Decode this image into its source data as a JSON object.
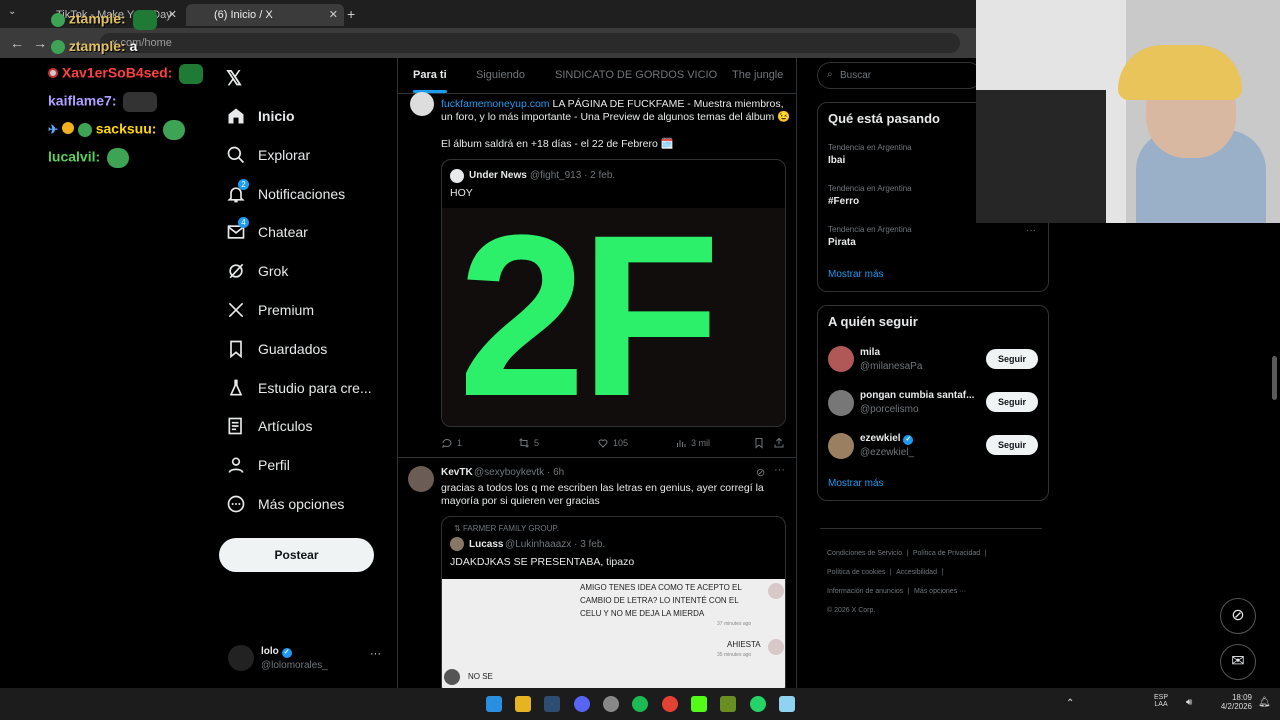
{
  "browser": {
    "tabs": [
      {
        "label": "TikTok - Make Your Day"
      },
      {
        "label": "(6) Inicio / X"
      }
    ],
    "url": "x.com/home"
  },
  "chat": [
    {
      "user": "ztample:",
      "msg": "",
      "color": "#e0c060"
    },
    {
      "user": "ztample:",
      "msg": "a",
      "color": "#e0c060"
    },
    {
      "user": "Xav1erSoB4sed:",
      "msg": "",
      "color": "#ff4040"
    },
    {
      "user": "kaiflame7:",
      "msg": "",
      "color": "#b0a0ff"
    },
    {
      "user": "sacksuu:",
      "msg": "",
      "color": "#ffd700"
    },
    {
      "user": "lucalvil:",
      "msg": "",
      "color": "#5bd05b"
    }
  ],
  "sidebar": {
    "items": [
      {
        "label": "Inicio",
        "icon": "home-icon"
      },
      {
        "label": "Explorar",
        "icon": "search-icon"
      },
      {
        "label": "Notificaciones",
        "icon": "bell-icon",
        "badge": "2"
      },
      {
        "label": "Chatear",
        "icon": "mail-icon",
        "badge": "4"
      },
      {
        "label": "Grok",
        "icon": "grok-icon"
      },
      {
        "label": "Premium",
        "icon": "x-icon"
      },
      {
        "label": "Guardados",
        "icon": "bookmark-icon"
      },
      {
        "label": "Estudio para cre...",
        "icon": "flask-icon"
      },
      {
        "label": "Artículos",
        "icon": "article-icon"
      },
      {
        "label": "Perfil",
        "icon": "person-icon"
      },
      {
        "label": "Más opciones",
        "icon": "more-icon"
      }
    ],
    "post_label": "Postear",
    "account": {
      "name": "lolo",
      "handle": "@lolomorales_"
    }
  },
  "main": {
    "tabs": [
      "Para ti",
      "Siguiendo",
      "SINDICATO DE GORDOS VICIO",
      "The jungle"
    ],
    "post1": {
      "link": "fuckfamemoneyup.com",
      "text": "LA PÁGINA DE FUCKFAME - Muestra miembros, un foro, y lo más importante - Una Preview de algunos temas del álbum 😉",
      "text2": "El álbum saldrá en +18 días - el 22 de Febrero 🗓️",
      "quote": {
        "name": "Under News",
        "handle": "@fight_913 · 2 feb.",
        "text": "HOY",
        "image_text": "2F"
      },
      "stats": {
        "replies": "1",
        "reposts": "5",
        "likes": "105",
        "views": "3 mil"
      }
    },
    "post2": {
      "name": "KevTK",
      "handle": "@sexyboykevtk · 6h",
      "text": "gracias a todos los q me escriben las letras en genius, ayer corregí la mayoría por si quieren ver gracias",
      "quote": {
        "context": "FARMER FAMILY GROUP.",
        "name": "Lucass",
        "handle": "@Lukinhaaazx · 3 feb.",
        "text": "JDAKDJKAS SE PRESENTABA, tipazo",
        "chat1": "AMIGO TENES IDEA COMO TE ACEPTO EL CAMBIO DE LETRA? LO INTENTÉ CON EL CELU Y NO ME DEJA LA MIERDA",
        "chat1_time": "37 minutes ago",
        "chat2": "AHIESTA",
        "chat2_time": "35 minutes ago",
        "chat3": "NO SE"
      }
    }
  },
  "right": {
    "search_placeholder": "Buscar",
    "trends_title": "Qué está pasando",
    "trends": [
      {
        "context": "Tendencia en Argentina",
        "name": "Ibai"
      },
      {
        "context": "Tendencia en Argentina",
        "name": "#Ferro"
      },
      {
        "context": "Tendencia en Argentina",
        "name": "Pirata"
      }
    ],
    "show_more": "Mostrar más",
    "follow_title": "A quién seguir",
    "follow": [
      {
        "name": "mila",
        "handle": "@milanesaPa",
        "button": "Seguir"
      },
      {
        "name": "pongan cumbia santaf...",
        "handle": "@porcelismo",
        "button": "Seguir"
      },
      {
        "name": "ezewkiel",
        "handle": "@ezewkiel_",
        "button": "Seguir"
      }
    ],
    "show_more2": "Mostrar más",
    "footer": [
      "Condiciones de Servicio",
      "Política de Privacidad",
      "Política de cookies",
      "Accesibilidad",
      "Información de anuncios",
      "Más opciones ···",
      "© 2026 X Corp."
    ]
  },
  "taskbar": {
    "lang": "ESP",
    "lang2": "LAA",
    "time": "18:09",
    "date": "4/2/2026"
  }
}
